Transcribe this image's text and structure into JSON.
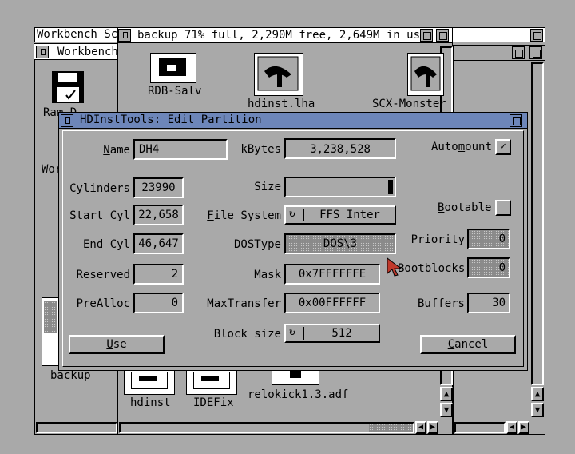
{
  "screen": {
    "workbench_title": "Workbench Sc",
    "workbench_window_title": "Workbench",
    "backup_window_title": "backup  71% full, 2,290M free, 2,649M in us",
    "icons": {
      "ram_disk": "Ram D",
      "work": "Wor",
      "backup": "backup",
      "rdb_salv": "RDB-Salv",
      "hdinst_lha": "hdinst.lha",
      "scx_monster": "SCX-Monster",
      "hdinst": "hdinst",
      "idefix": "IDEFix",
      "relokick": "relokick1.3.adf"
    }
  },
  "dialog": {
    "title": "HDInstTools: Edit Partition",
    "name_label": "Name",
    "name_value": "DH4",
    "kbytes_label": "kBytes",
    "kbytes_value": "3,238,528",
    "automount_label": "Automount",
    "automount_checked": true,
    "cylinders_label": "Cylinders",
    "cylinders_value": "23990",
    "size_label": "Size",
    "size_fill": 0.97,
    "bootable_label": "Bootable",
    "bootable_checked": false,
    "start_cyl_label": "Start Cyl",
    "start_cyl_value": "22,658",
    "file_system_label": "File System",
    "file_system_value": "FFS Inter",
    "end_cyl_label": "End Cyl",
    "end_cyl_value": "46,647",
    "dostype_label": "DOSType",
    "dostype_value": "DOS\\3",
    "priority_label": "Priority",
    "priority_value": "0",
    "reserved_label": "Reserved",
    "reserved_value": "2",
    "mask_label": "Mask",
    "mask_value": "0x7FFFFFFE",
    "bootblocks_label": "Bootblocks",
    "bootblocks_value": "0",
    "prealloc_label": "PreAlloc",
    "prealloc_value": "0",
    "maxtransfer_label": "MaxTransfer",
    "maxtransfer_value": "0x00FFFFFF",
    "buffers_label": "Buffers",
    "buffers_value": "30",
    "blocksize_label": "Block size",
    "blocksize_value": "512",
    "use_label": "Use",
    "cancel_label": "Cancel"
  },
  "colors": {
    "active_title": "#6d86b9",
    "background": "#a9a9a9",
    "pointer": "#c0392b"
  }
}
